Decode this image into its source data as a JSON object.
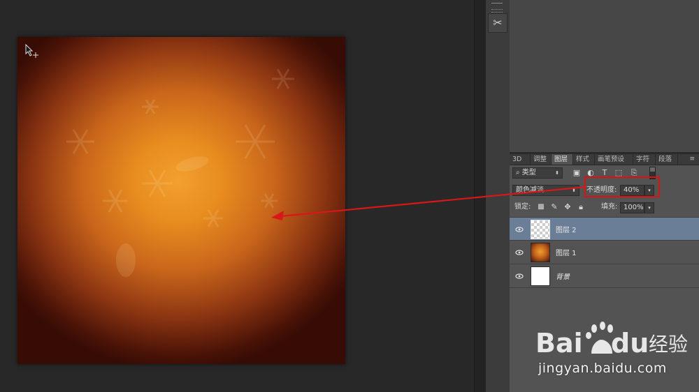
{
  "panels": {
    "tabs": [
      {
        "label": "3D",
        "active": false
      },
      {
        "label": "调整",
        "active": false
      },
      {
        "label": "图层",
        "active": true
      },
      {
        "label": "样式",
        "active": false
      },
      {
        "label": "画笔预设",
        "active": false
      },
      {
        "label": "字符",
        "active": false
      },
      {
        "label": "段落",
        "active": false
      }
    ]
  },
  "layers_panel": {
    "filter_kind": "类型",
    "blend_mode": "颜色减淡",
    "opacity_label": "不透明度:",
    "opacity_value": "40%",
    "lock_label": "锁定:",
    "fill_label": "填充:",
    "fill_value": "100%",
    "layers": [
      {
        "name": "图层 2",
        "selected": true,
        "thumb": "transparent",
        "visible": true
      },
      {
        "name": "图层 1",
        "selected": false,
        "thumb": "orange-gradient",
        "visible": true
      },
      {
        "name": "背景",
        "selected": false,
        "thumb": "white",
        "visible": true
      }
    ]
  },
  "annotation": {
    "highlight_color": "#e01010",
    "arrow_color": "#d81818"
  },
  "watermark": {
    "logo": "Bai du 经验",
    "url": "jingyan.baidu.com"
  },
  "colors": {
    "workspace": "#282828",
    "panel": "#535353",
    "selected_row": "#6b7e97",
    "canvas_center": "#f2a030",
    "canvas_edge": "#360c04"
  }
}
